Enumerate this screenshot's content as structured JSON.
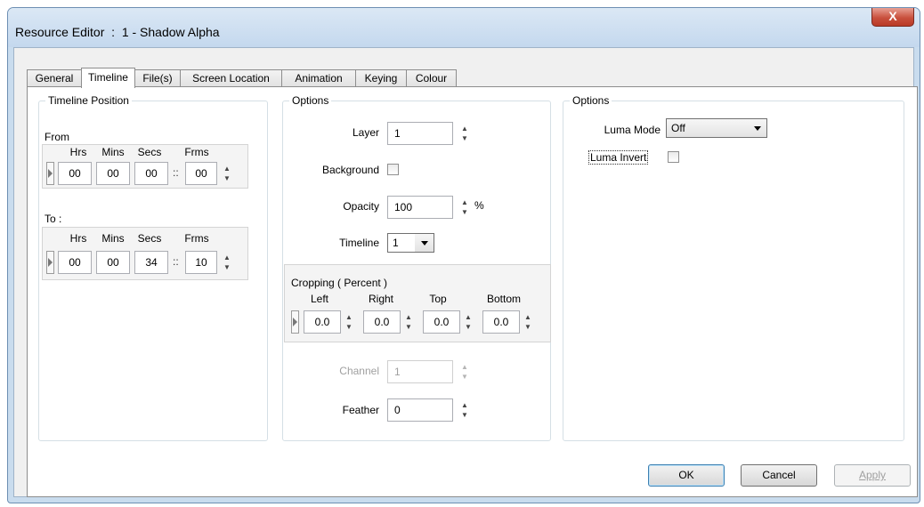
{
  "window": {
    "title": "Resource Editor  :  1 - Shadow Alpha",
    "close_glyph": "X"
  },
  "tabs": [
    {
      "label": "General"
    },
    {
      "label": "Timeline",
      "active": true
    },
    {
      "label": "File(s)"
    },
    {
      "label": "Screen Location"
    },
    {
      "label": "Animation"
    },
    {
      "label": "Keying"
    },
    {
      "label": "Colour"
    }
  ],
  "timeline_position": {
    "title": "Timeline Position",
    "from": {
      "label": "From",
      "hrs_label": "Hrs",
      "mins_label": "Mins",
      "secs_label": "Secs",
      "frms_label": "Frms",
      "hrs": "00",
      "mins": "00",
      "secs": "00",
      "frms": "00",
      "separator": "::"
    },
    "to": {
      "label": "To :",
      "hrs_label": "Hrs",
      "mins_label": "Mins",
      "secs_label": "Secs",
      "frms_label": "Frms",
      "hrs": "00",
      "mins": "00",
      "secs": "34",
      "frms": "10",
      "separator": "::"
    }
  },
  "options_middle": {
    "title": "Options",
    "layer_label": "Layer",
    "layer_value": "1",
    "background_label": "Background",
    "background_checked": false,
    "opacity_label": "Opacity",
    "opacity_value": "100",
    "opacity_unit": "%",
    "timeline_label": "Timeline",
    "timeline_value": "1",
    "cropping": {
      "title": "Cropping ( Percent )",
      "left_label": "Left",
      "right_label": "Right",
      "top_label": "Top",
      "bottom_label": "Bottom",
      "left": "0.0",
      "right": "0.0",
      "top": "0.0",
      "bottom": "0.0"
    },
    "channel_label": "Channel",
    "channel_value": "1",
    "feather_label": "Feather",
    "feather_value": "0"
  },
  "options_right": {
    "title": "Options",
    "luma_mode_label": "Luma Mode",
    "luma_mode_value": "Off",
    "luma_invert_label": "Luma Invert",
    "luma_invert_checked": false
  },
  "buttons": {
    "ok": "OK",
    "cancel": "Cancel",
    "apply": "Apply"
  },
  "icons": {
    "spin": "▲▼",
    "expand": "play-arrow-icon"
  }
}
